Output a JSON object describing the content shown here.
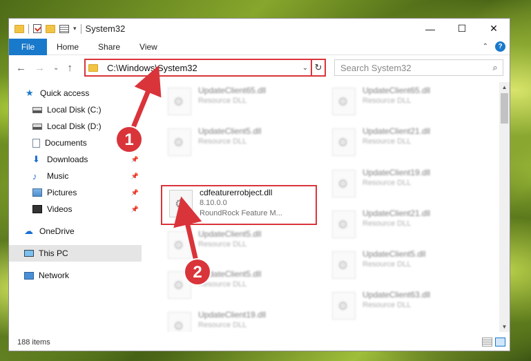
{
  "window": {
    "title": "System32",
    "controls": {
      "minimize": "—",
      "maximize": "☐",
      "close": "✕"
    }
  },
  "ribbon": {
    "tabs": [
      "File",
      "Home",
      "Share",
      "View"
    ],
    "help": "?",
    "collapse": "⌃"
  },
  "nav": {
    "back": "←",
    "forward": "→",
    "recent": "⌄",
    "up": "↑",
    "address": "C:\\Windows\\System32",
    "address_dropdown": "⌄",
    "refresh": "↻",
    "search_placeholder": "Search System32",
    "search_icon": "⌕"
  },
  "sidebar": {
    "items": [
      {
        "label": "Quick access",
        "icon": "star-icon"
      },
      {
        "label": "Local Disk (C:)",
        "icon": "drive-icon"
      },
      {
        "label": "Local Disk (D:)",
        "icon": "drive-icon"
      },
      {
        "label": "Documents",
        "icon": "document-icon"
      },
      {
        "label": "Downloads",
        "icon": "download-icon"
      },
      {
        "label": "Music",
        "icon": "music-icon"
      },
      {
        "label": "Pictures",
        "icon": "picture-icon"
      },
      {
        "label": "Videos",
        "icon": "video-icon"
      },
      {
        "label": "OneDrive",
        "icon": "cloud-icon"
      },
      {
        "label": "This PC",
        "icon": "computer-icon"
      },
      {
        "label": "Network",
        "icon": "network-icon"
      }
    ],
    "pin": "📌"
  },
  "files": {
    "left": [
      {
        "name": "UpdateClient65.dll",
        "type": "Resource DLL"
      },
      {
        "name": "UpdateClient5.dll",
        "type": "Resource DLL"
      },
      {
        "name": "cdfeaturerrobject.dll",
        "version": "8.10.0.0",
        "desc": "RoundRock Feature M..."
      },
      {
        "name": "UpdateClient5.dll",
        "type": "Resource DLL"
      },
      {
        "name": "UpdateClient5.dll",
        "type": "Resource DLL"
      },
      {
        "name": "UpdateClient19.dll",
        "type": "Resource DLL"
      }
    ],
    "right": [
      {
        "name": "UpdateClient65.dll",
        "type": "Resource DLL"
      },
      {
        "name": "UpdateClient21.dll",
        "type": "Resource DLL"
      },
      {
        "name": "UpdateClient19.dll",
        "type": "Resource DLL"
      },
      {
        "name": "UpdateClient21.dll",
        "type": "Resource DLL"
      },
      {
        "name": "UpdateClient5.dll",
        "type": "Resource DLL"
      },
      {
        "name": "UpdateClient63.dll",
        "type": "Resource DLL"
      }
    ]
  },
  "status": {
    "count": "188 items"
  },
  "annotations": {
    "step1": "1",
    "step2": "2",
    "color": "#d9343a"
  }
}
